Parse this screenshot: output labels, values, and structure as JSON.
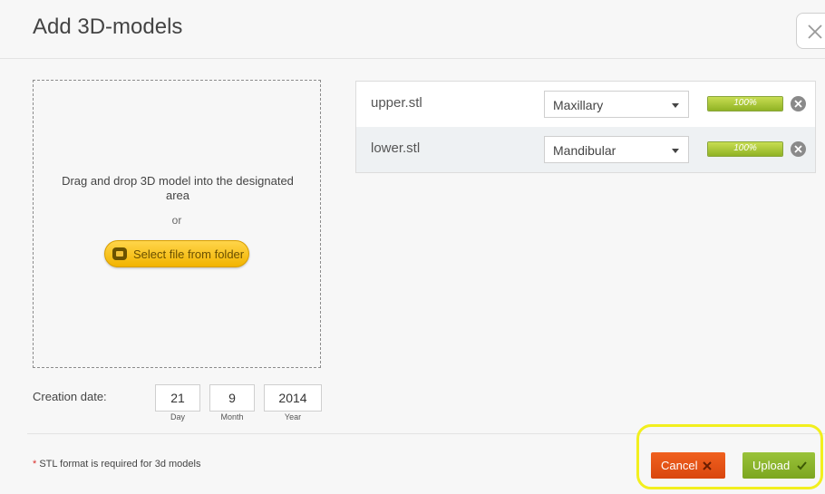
{
  "dialog": {
    "title": "Add 3D-models"
  },
  "dropzone": {
    "instruction": "Drag and drop 3D model into the designated area",
    "or": "or",
    "select_button_label": "Select file from folder"
  },
  "creation_date": {
    "label": "Creation date:",
    "day": "21",
    "day_caption": "Day",
    "month": "9",
    "month_caption": "Month",
    "year": "2014",
    "year_caption": "Year"
  },
  "files": [
    {
      "name": "upper.stl",
      "jaw": "Maxillary",
      "progress_label": "100%",
      "progress": 100
    },
    {
      "name": "lower.stl",
      "jaw": "Mandibular",
      "progress_label": "100%",
      "progress": 100
    }
  ],
  "footer": {
    "note_star": "*",
    "note": " STL format is required for 3d models",
    "cancel_label": "Cancel",
    "upload_label": "Upload"
  },
  "colors": {
    "cancel": "#e35316",
    "upload": "#8cb72e",
    "highlight": "#f2ef1e",
    "progress_fill": "#a6c43a"
  },
  "icons": {
    "close": "close-icon",
    "folder": "folder-icon",
    "remove": "remove-circle-icon",
    "cancel": "x-icon",
    "upload": "checkmark-icon",
    "dropdown": "chevron-down-icon"
  }
}
